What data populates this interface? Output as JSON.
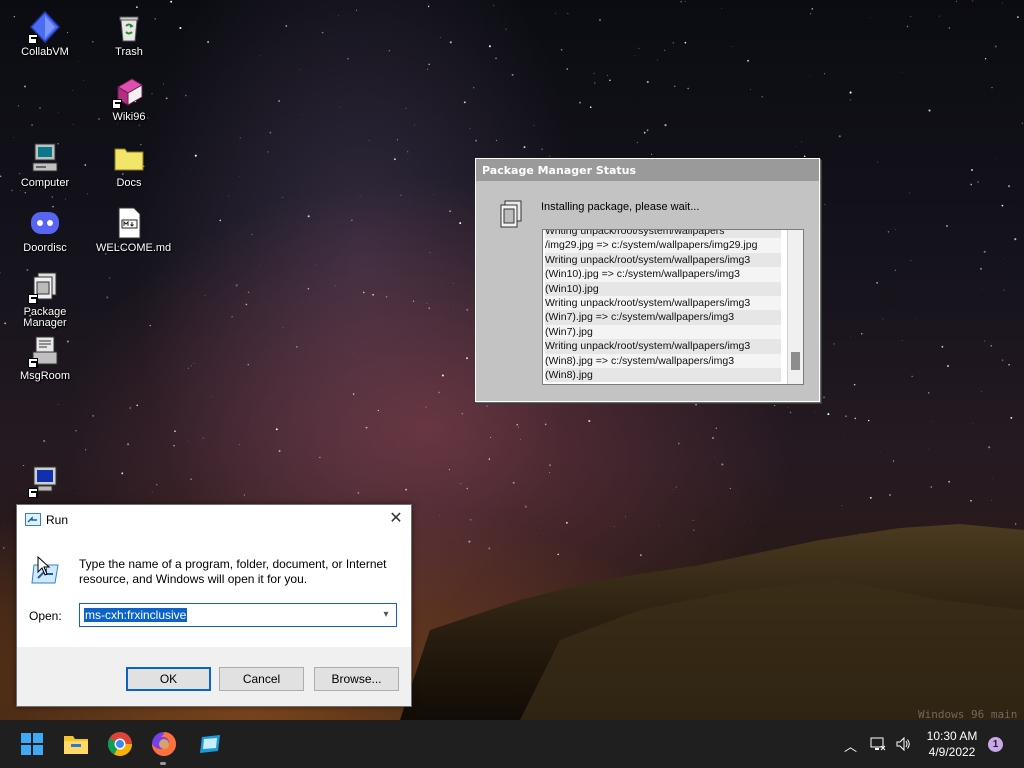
{
  "desktop": {
    "icons": [
      {
        "label": "CollabVM"
      },
      {
        "label": "Trash"
      },
      {
        "label": "Wiki96"
      },
      {
        "label": "Computer"
      },
      {
        "label": "Docs"
      },
      {
        "label": "Doordisc"
      },
      {
        "label": "WELCOME.md"
      },
      {
        "label": "Package Manager"
      },
      {
        "label": "MsgRoom"
      },
      {
        "label": ""
      }
    ],
    "watermark": "Windows 96 main"
  },
  "package_manager": {
    "title": "Package Manager Status",
    "message": "Installing package, please wait...",
    "log_lines": [
      "Writing unpack/root/system/wallpapers",
      "/img29.jpg => c:/system/wallpapers/img29.jpg",
      "Writing unpack/root/system/wallpapers/img3",
      "(Win10).jpg => c:/system/wallpapers/img3",
      "(Win10).jpg",
      "Writing unpack/root/system/wallpapers/img3",
      "(Win7).jpg => c:/system/wallpapers/img3",
      "(Win7).jpg",
      "Writing unpack/root/system/wallpapers/img3",
      "(Win8).jpg => c:/system/wallpapers/img3",
      "(Win8).jpg"
    ]
  },
  "run_dialog": {
    "title": "Run",
    "description": "Type the name of a program, folder, document, or Internet resource, and Windows will open it for you.",
    "open_label": "Open:",
    "open_value": "ms-cxh:frxinclusive",
    "ok_label": "OK",
    "cancel_label": "Cancel",
    "browse_label": "Browse..."
  },
  "taskbar": {
    "pinned": [
      "start-icon",
      "file-explorer-icon",
      "chrome-icon",
      "firefox-icon",
      "windows96-icon"
    ],
    "time": "10:30 AM",
    "date": "4/9/2022",
    "notification_count": "1"
  },
  "colors": {
    "accent": "#0b63c9",
    "taskbar": "#1f1f1f",
    "win96_gray": "#c3c3c3"
  }
}
